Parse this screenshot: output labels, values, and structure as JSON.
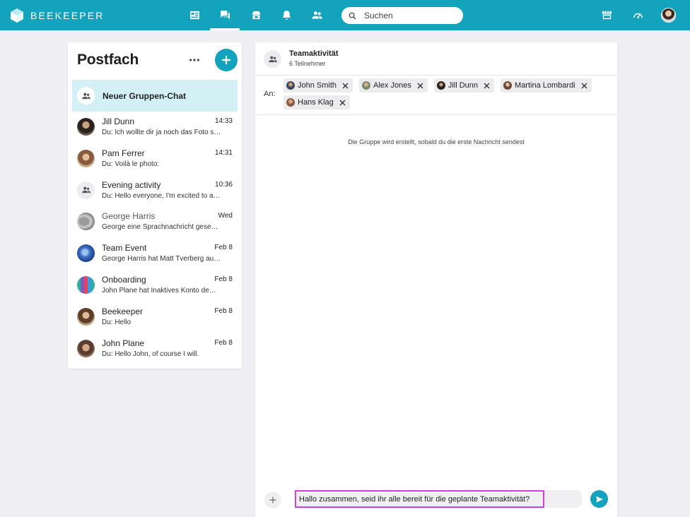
{
  "app": {
    "brand": "BEEKEEPER",
    "brand_color": "#14a3bc",
    "nav_icons": [
      "newsfeed-icon",
      "chat-icon",
      "apps-icon",
      "notifications-icon",
      "people-icon"
    ],
    "active_nav": "chat-icon",
    "right_icons": [
      "store-icon",
      "dashboard-icon"
    ]
  },
  "search": {
    "placeholder": "Suchen",
    "value": ""
  },
  "inbox": {
    "title": "Postfach",
    "new_group_chat": "Neuer Gruppen-Chat",
    "conversations": [
      {
        "name": "Jill Dunn",
        "time": "14:33",
        "preview": "Du: Ich wollte dir ja noch das Foto schicken",
        "avatar": "photo-jill"
      },
      {
        "name": "Pam Ferrer",
        "time": "14:31",
        "preview": "Du: Voilà le photo:",
        "avatar": "photo-pam"
      },
      {
        "name": "Evening activity",
        "time": "10:36",
        "preview": "Du: Hello everyone, I'm excited to announce",
        "avatar": "group-icon"
      },
      {
        "name": "George Harris",
        "time": "Wed",
        "preview": "George eine Sprachnachricht gesendet",
        "avatar": "photo-george",
        "muted": true
      },
      {
        "name": "Team Event",
        "time": "Feb 8",
        "preview": "George Harris hat Matt Tverberg ausgewählt",
        "avatar": "photo-team"
      },
      {
        "name": "Onboarding",
        "time": "Feb 8",
        "preview": "John Plane hat Inaktives Konto demnächst",
        "avatar": "photo-onboarding"
      },
      {
        "name": "Beekeeper",
        "time": "Feb 8",
        "preview": "Du: Hello",
        "avatar": "photo-beekeeper"
      },
      {
        "name": "John Plane",
        "time": "Feb 8",
        "preview": "Du: Hello John, of course I will.",
        "avatar": "photo-john"
      }
    ]
  },
  "chat": {
    "title": "Teamaktivität",
    "subtitle": "6 Teilnehmer",
    "to_label": "An:",
    "recipients": [
      "John Smith",
      "Alex Jones",
      "Jill Dunn",
      "Martina Lombardi",
      "Hans Klag"
    ],
    "notice": "Die Gruppe wird erstellt, sobald du die erste Nachricht sendest",
    "message_value": "Hallo zusammen, seid ihr alle bereit für die geplante Teamaktivität?"
  }
}
